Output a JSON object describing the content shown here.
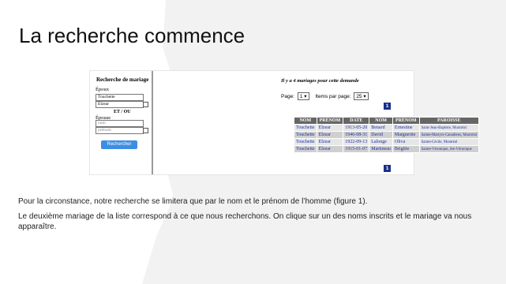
{
  "slide": {
    "title": "La recherche commence",
    "paragraph1": "Pour la circonstance, notre recherche se limitera que par le nom et le prénom de l’homme (figure 1).",
    "paragraph2": "Le deuxième mariage de la liste correspond à ce que nous recherchons. On clique sur un des noms inscrits et le mariage va nous apparaître."
  },
  "search_form": {
    "title": "Recherche de mariage",
    "epoux_label": "Époux",
    "epoux_nom_value": "Touchette",
    "epoux_prenom_value": "Elzear",
    "et_ou": "ET / OU",
    "epouse_label": "Épouse",
    "epouse_nom_placeholder": "nom",
    "epouse_prenom_placeholder": "prénom",
    "button_label": "Rechercher"
  },
  "results": {
    "count_text": "Il y a 4 mariages pour cette demande",
    "page_label": "Page:",
    "page_value": "1",
    "items_label": "Items par page:",
    "items_value": "25",
    "page_link": "1",
    "headers": [
      "NOM",
      "PRÉNOM",
      "DATE",
      "NOM",
      "PRÉNOM",
      "PAROISSE"
    ],
    "rows": [
      {
        "nom1": "Touchette",
        "prenom1": "Elzear",
        "date": "1913-05-20",
        "nom2": "Benard",
        "prenom2": "Ernestine",
        "paroisse": "Saint-Jean-Baptiste, Montréal"
      },
      {
        "nom1": "Touchette",
        "prenom1": "Elzear",
        "date": "1946-08-31",
        "nom2": "David",
        "prenom2": "Marguerite",
        "paroisse": "Sainte-Martyrs-Canadiens, Montréal"
      },
      {
        "nom1": "Touchette",
        "prenom1": "Elzear",
        "date": "1922-09-13",
        "nom2": "Lalonge",
        "prenom2": "Oliva",
        "paroisse": "Sainte-Cécile, Montréal"
      },
      {
        "nom1": "Touchette",
        "prenom1": "Elzear",
        "date": "1915-01-07",
        "nom2": "Martineau",
        "prenom2": "Brigitte",
        "paroisse": "Sainte-Véronique, Ste-Véronique"
      }
    ]
  },
  "colors": {
    "accent_button": "#3d8ee3",
    "page_badge": "#1a2f8a",
    "highlight_arrow": "#f2e600"
  },
  "icons": [
    "arrow-right-icon",
    "chevron-down-icon"
  ]
}
